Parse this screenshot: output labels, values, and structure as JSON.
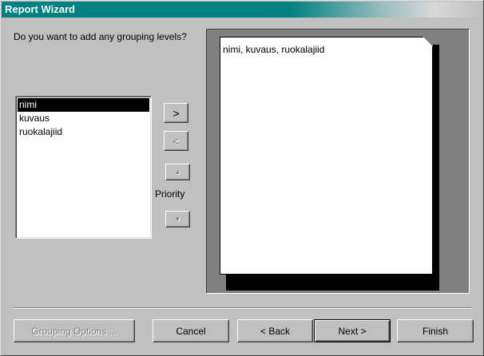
{
  "window": {
    "title": "Report Wizard"
  },
  "question": "Do you want to add any grouping levels?",
  "fields": {
    "items": [
      "nimi",
      "kuvaus",
      "ruokalajiid"
    ],
    "selected_index": 0
  },
  "controls": {
    "add": ">",
    "remove": "<",
    "priority_label": "Priority"
  },
  "preview": {
    "text": "nimi, kuvaus, ruokalajiid"
  },
  "footer": {
    "grouping_options": "Grouping Options ...",
    "cancel": "Cancel",
    "back": "< Back",
    "next": "Next >",
    "finish": "Finish"
  },
  "colors": {
    "titlebar": "#008080",
    "face": "#c0c0c0"
  },
  "icons": {
    "up": "up-triangle-icon",
    "down": "down-triangle-icon",
    "page": "page-fold-icon"
  }
}
